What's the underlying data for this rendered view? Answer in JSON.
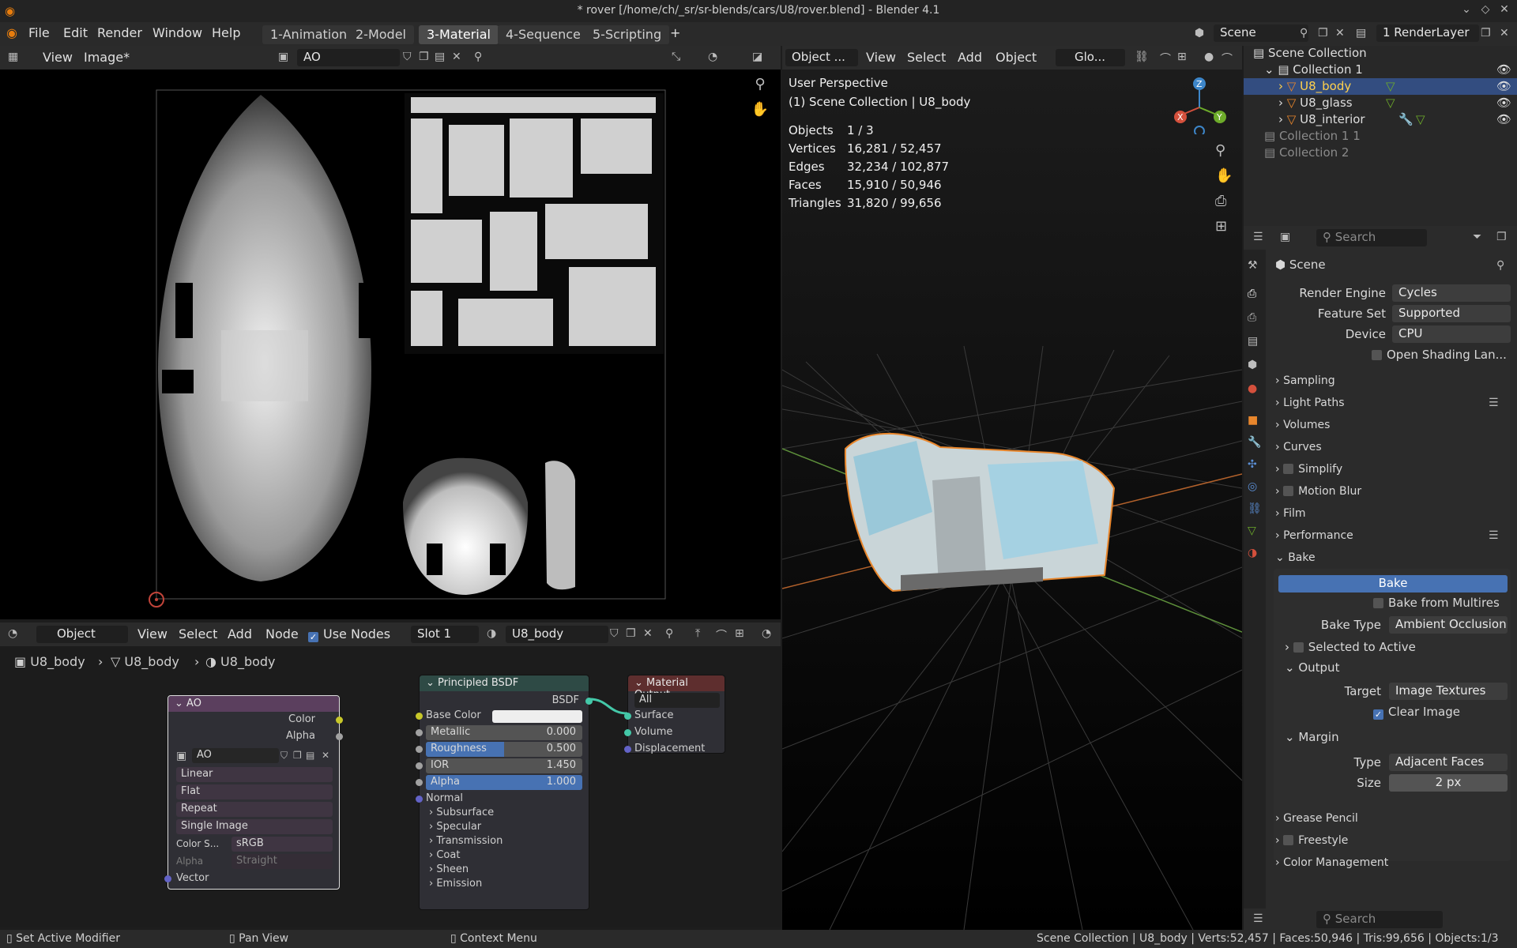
{
  "window": {
    "title": "* rover [/home/ch/_sr/sr-blends/cars/U8/rover.blend] - Blender 4.1"
  },
  "menu": {
    "file": "File",
    "edit": "Edit",
    "render": "Render",
    "window": "Window",
    "help": "Help"
  },
  "workspaces": [
    "1-Animation",
    "2-Model",
    "3-Material",
    "4-Sequence",
    "5-Scripting"
  ],
  "active_workspace": "3-Material",
  "scene": {
    "name": "Scene",
    "layer": "1 RenderLayer"
  },
  "image_editor": {
    "view": "View",
    "image_menu": "Image*",
    "image_name": "AO"
  },
  "viewport": {
    "mode": "Object ...",
    "view": "View",
    "select": "Select",
    "add": "Add",
    "object": "Object",
    "orientation": "Glo...",
    "perspective": "User Perspective",
    "collection_line": "(1) Scene Collection | U8_body",
    "stats": [
      {
        "label": "Objects",
        "value": "1 / 3"
      },
      {
        "label": "Vertices",
        "value": "16,281 / 52,457"
      },
      {
        "label": "Edges",
        "value": "32,234 / 102,877"
      },
      {
        "label": "Faces",
        "value": "15,910 / 50,946"
      },
      {
        "label": "Triangles",
        "value": "31,820 / 99,656"
      }
    ],
    "gizmo": {
      "x": "X",
      "y": "Y",
      "z": "Z"
    }
  },
  "outliner": {
    "items": [
      {
        "label": "Scene Collection"
      },
      {
        "label": "Collection 1"
      },
      {
        "label": "U8_body"
      },
      {
        "label": "U8_glass"
      },
      {
        "label": "U8_interior"
      },
      {
        "label": "Collection 1 1"
      },
      {
        "label": "Collection 2"
      }
    ],
    "search_placeholder": "Search"
  },
  "properties": {
    "context": "Scene",
    "render_engine": {
      "label": "Render Engine",
      "value": "Cycles"
    },
    "feature_set": {
      "label": "Feature Set",
      "value": "Supported"
    },
    "device": {
      "label": "Device",
      "value": "CPU"
    },
    "osl": "Open Shading Lan...",
    "sections": {
      "sampling": "Sampling",
      "light_paths": "Light Paths",
      "volumes": "Volumes",
      "curves": "Curves",
      "simplify": "Simplify",
      "motion_blur": "Motion Blur",
      "film": "Film",
      "performance": "Performance",
      "bake": "Bake",
      "grease_pencil": "Grease Pencil",
      "freestyle": "Freestyle",
      "color_management": "Color Management"
    },
    "bake": {
      "button": "Bake",
      "from_multires": "Bake from Multires",
      "type_label": "Bake Type",
      "type_value": "Ambient Occlusion",
      "selected_to_active": "Selected to Active",
      "output": "Output",
      "target_label": "Target",
      "target_value": "Image Textures",
      "clear_image": "Clear Image",
      "margin": "Margin",
      "margin_type_label": "Type",
      "margin_type_value": "Adjacent Faces",
      "size_label": "Size",
      "size_value": "2 px"
    },
    "search_placeholder": "Search"
  },
  "node_editor": {
    "mode": "Object",
    "view": "View",
    "select": "Select",
    "add": "Add",
    "node": "Node",
    "use_nodes": "Use Nodes",
    "slot": "Slot 1",
    "material": "U8_body",
    "breadcrumb": [
      "U8_body",
      "U8_body",
      "U8_body"
    ],
    "ao_node": {
      "title": "AO",
      "out_color": "Color",
      "out_alpha": "Alpha",
      "image": "AO",
      "interp": "Linear",
      "proj": "Flat",
      "ext": "Repeat",
      "source": "Single Image",
      "cs_label": "Color S...",
      "cs_value": "sRGB",
      "alpha_label": "Alpha",
      "alpha_value": "Straight",
      "vector": "Vector"
    },
    "bsdf": {
      "title": "Principled BSDF",
      "out": "BSDF",
      "base_color": "Base Color",
      "metallic": "Metallic",
      "metallic_v": "0.000",
      "roughness": "Roughness",
      "roughness_v": "0.500",
      "ior": "IOR",
      "ior_v": "1.450",
      "alpha": "Alpha",
      "alpha_v": "1.000",
      "normal": "Normal",
      "subs": [
        "Subsurface",
        "Specular",
        "Transmission",
        "Coat",
        "Sheen",
        "Emission"
      ]
    },
    "output": {
      "title": "Material Output",
      "target": "All",
      "surface": "Surface",
      "volume": "Volume",
      "displacement": "Displacement"
    }
  },
  "statusbar": {
    "left1": "Set Active Modifier",
    "left2": "Pan View",
    "left3": "Context Menu",
    "right": "Scene Collection | U8_body | Verts:52,457 | Faces:50,946 | Tris:99,656 | Objects:1/3"
  }
}
